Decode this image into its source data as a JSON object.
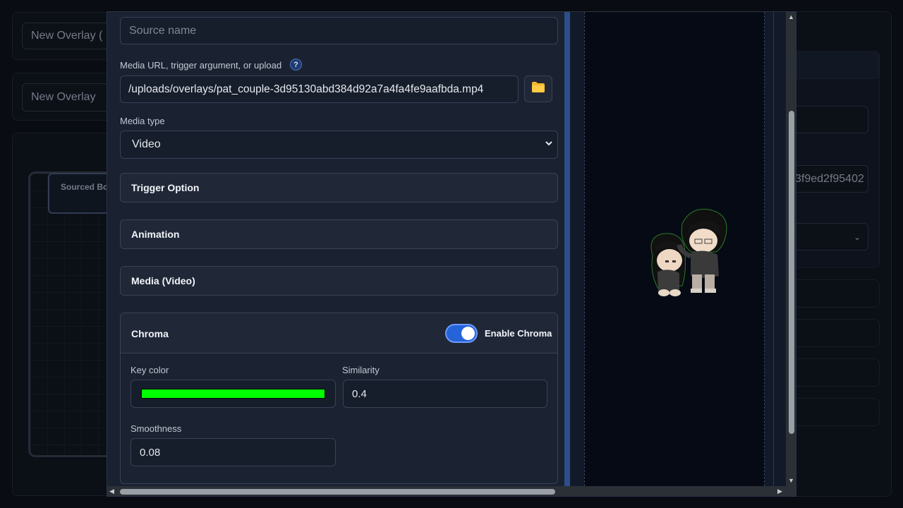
{
  "background": {
    "overlay_name_1": "New Overlay (",
    "overlay_name_2": "New Overlay",
    "sourced_box_label": "Sourced Bo",
    "hash_fragment": "3f9ed2f95402"
  },
  "form": {
    "source_name_placeholder": "Source name",
    "media_url_label": "Media URL, trigger argument, or upload",
    "media_url_value": "/uploads/overlays/pat_couple-3d95130abd384d92a7a4fa4fe9aafbda.mp4",
    "media_type_label": "Media type",
    "media_type_value": "Video",
    "sections": [
      "Trigger Option",
      "Animation",
      "Media (Video)"
    ],
    "chroma": {
      "title": "Chroma",
      "enable_label": "Enable Chroma",
      "enabled": true,
      "key_color_label": "Key color",
      "key_color": "#00ff00",
      "similarity_label": "Similarity",
      "similarity_value": "0.4",
      "smoothness_label": "Smoothness",
      "smoothness_value": "0.08"
    }
  },
  "icons": {
    "help": "question-mark-icon",
    "folder": "folder-icon",
    "select": "chevron-down-icon"
  },
  "colors": {
    "accent": "#2563d9",
    "panel": "#1a2130",
    "preview_bg": "#050a14"
  }
}
